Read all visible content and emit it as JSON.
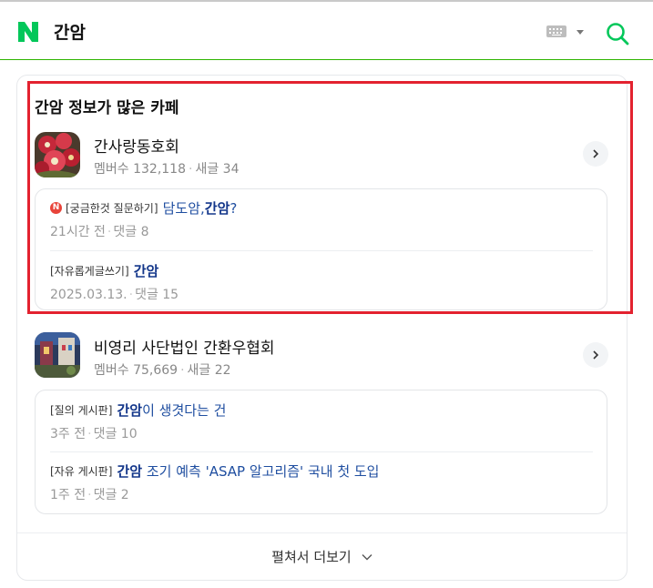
{
  "header": {
    "query": "간암",
    "brand_color": "#03c75a"
  },
  "section": {
    "title": "간암 정보가 많은 카페"
  },
  "cafes": [
    {
      "name": "간사랑동호회",
      "members_label": "멤버수",
      "members": "132,118",
      "new_posts_label": "새글",
      "new_posts": "34",
      "posts": [
        {
          "has_new_badge": true,
          "badge": "N",
          "category": "[궁금한것 질문하기]",
          "title_prefix": "담도암,",
          "title_keyword": "간암",
          "title_suffix": "?",
          "time": "21시간 전",
          "comments": "댓글 8"
        },
        {
          "has_new_badge": false,
          "category": "[자유롭게글쓰기]",
          "title_prefix": "",
          "title_keyword": "간암",
          "title_suffix": "",
          "time": "2025.03.13.",
          "comments": "댓글 15"
        }
      ]
    },
    {
      "name": "비영리 사단법인 간환우협회",
      "members_label": "멤버수",
      "members": "75,669",
      "new_posts_label": "새글",
      "new_posts": "22",
      "posts": [
        {
          "has_new_badge": false,
          "category": "[질의 게시판]",
          "title_prefix": "",
          "title_keyword": "간암",
          "title_suffix": "이 생겻다는 건",
          "time": "3주 전",
          "comments": "댓글 10"
        },
        {
          "has_new_badge": false,
          "category": "[자유 게시판]",
          "title_prefix": "",
          "title_keyword": "간암",
          "title_suffix": " 조기 예측 'ASAP 알고리즘' 국내 첫 도입",
          "time": "1주 전",
          "comments": "댓글 2"
        }
      ]
    }
  ],
  "more": {
    "label": "펼쳐서 더보기"
  },
  "icons": {
    "logo": "naver-n-logo-icon",
    "keyboard": "keyboard-icon",
    "dropdown": "caret-down-icon",
    "search": "search-icon",
    "arrow": "chevron-right-icon",
    "expand": "chevron-down-icon"
  },
  "colors": {
    "highlight": "#e3222f",
    "link": "#1f4ea0",
    "keyword": "#13368a"
  }
}
